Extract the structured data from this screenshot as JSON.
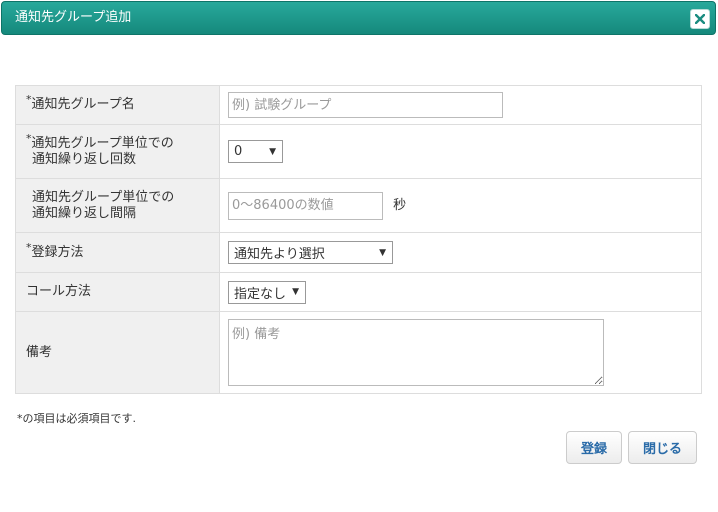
{
  "dialog": {
    "title": "通知先グループ追加",
    "close_label": "×"
  },
  "form": {
    "group_name": {
      "required_mark": "*",
      "label": "通知先グループ名",
      "placeholder": "例) 試験グループ",
      "value": ""
    },
    "repeat_count": {
      "required_mark": "*",
      "label_line1": "通知先グループ単位での",
      "label_line2": "通知繰り返し回数",
      "selected": "0"
    },
    "repeat_interval": {
      "label_line1": "通知先グループ単位での",
      "label_line2": "通知繰り返し間隔",
      "placeholder": "0〜86400の数値",
      "unit": "秒"
    },
    "registration_method": {
      "required_mark": "*",
      "label": "登録方法",
      "selected": "通知先より選択"
    },
    "call_method": {
      "label": "コール方法",
      "selected": "指定なし"
    },
    "memo": {
      "label": "備考",
      "placeholder": "例) 備考"
    }
  },
  "footer": {
    "required_note": "*の項目は必須項目です.",
    "register_button": "登録",
    "close_button": "閉じる"
  },
  "colors": {
    "titlebar": "#1a9a8c",
    "label_background": "#f0f0f0",
    "button_text": "#2a6ba8"
  }
}
